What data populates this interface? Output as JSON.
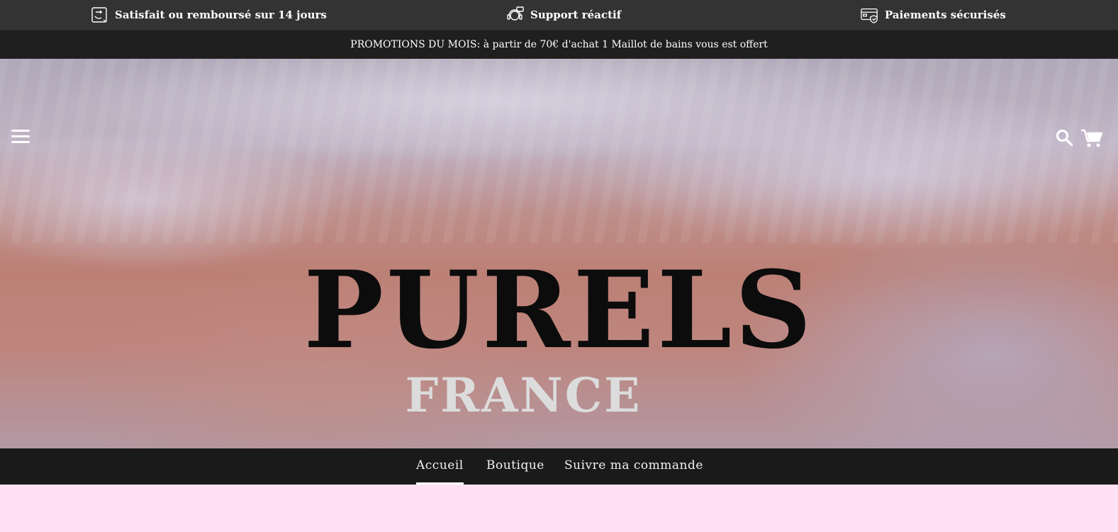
{
  "topbar": {
    "refund": "Satisfait ou remboursé sur 14 jours",
    "support": "Support réactif",
    "payments": "Paiements sécurisés"
  },
  "promo": {
    "text": "PROMOTIONS DU MOIS: à partir de 70€ d'achat 1 Maillot de bains vous est offert"
  },
  "hero": {
    "brand": "PURELS",
    "subtitle": "FRANCE"
  },
  "nav": {
    "items": [
      {
        "label": "Accueil",
        "active": true
      },
      {
        "label": "Boutique",
        "active": false
      },
      {
        "label": "Suivre ma commande",
        "active": false
      }
    ]
  },
  "colors": {
    "topbar": "#333333",
    "promo": "#1f1f1f",
    "nav": "#1a1a1a",
    "page_bg": "#ffe0f5"
  },
  "icons": {
    "refund": "refund-box-icon",
    "support": "headset-icon",
    "payments": "secure-card-icon",
    "menu": "hamburger-icon",
    "search": "search-icon",
    "cart": "cart-icon"
  }
}
